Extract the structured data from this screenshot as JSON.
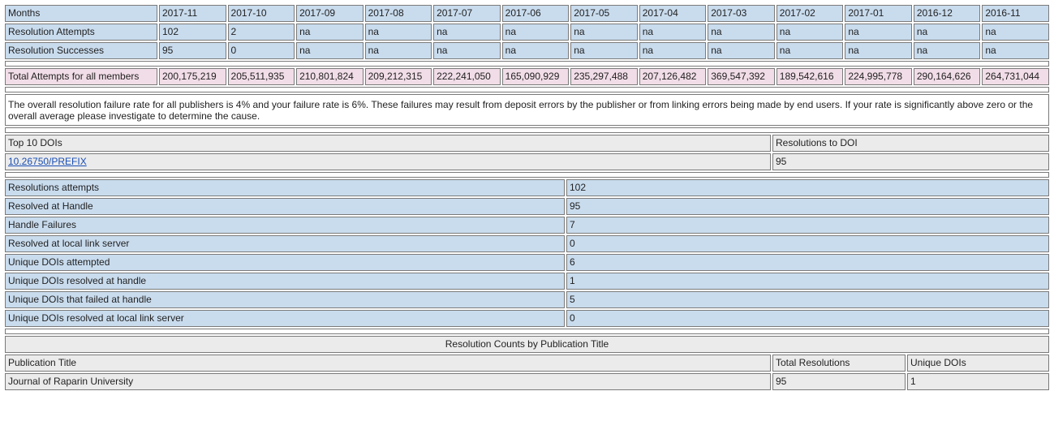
{
  "months_label": "Months",
  "months": [
    "2017-11",
    "2017-10",
    "2017-09",
    "2017-08",
    "2017-07",
    "2017-06",
    "2017-05",
    "2017-04",
    "2017-03",
    "2017-02",
    "2017-01",
    "2016-12",
    "2016-11"
  ],
  "attempts_label": "Resolution Attempts",
  "attempts": [
    "102",
    "2",
    "na",
    "na",
    "na",
    "na",
    "na",
    "na",
    "na",
    "na",
    "na",
    "na",
    "na"
  ],
  "successes_label": "Resolution Successes",
  "successes": [
    "95",
    "0",
    "na",
    "na",
    "na",
    "na",
    "na",
    "na",
    "na",
    "na",
    "na",
    "na",
    "na"
  ],
  "total_label": "Total Attempts for all members",
  "totals": [
    "200,175,219",
    "205,511,935",
    "210,801,824",
    "209,212,315",
    "222,241,050",
    "165,090,929",
    "235,297,488",
    "207,126,482",
    "369,547,392",
    "189,542,616",
    "224,995,778",
    "290,164,626",
    "264,731,044"
  ],
  "note": "The overall resolution failure rate for all publishers is 4% and your failure rate is 6%. These failures may result from deposit errors by the publisher or from linking errors being made by end users. If your rate is significantly above zero or the overall average please investigate to determine the cause.",
  "top_dois": {
    "header": "Top 10 DOIs",
    "count_header": "Resolutions to DOI",
    "rows": [
      {
        "doi": "10.26750/PREFIX",
        "count": "95"
      }
    ]
  },
  "summary": [
    {
      "label": "Resolutions attempts",
      "value": "102"
    },
    {
      "label": "Resolved at Handle",
      "value": "95"
    },
    {
      "label": "Handle Failures",
      "value": "7"
    },
    {
      "label": "Resolved at local link server",
      "value": "0"
    },
    {
      "label": "Unique DOIs attempted",
      "value": "6"
    },
    {
      "label": "Unique DOIs resolved at handle",
      "value": "1"
    },
    {
      "label": "Unique DOIs that failed at handle",
      "value": "5"
    },
    {
      "label": "Unique DOIs resolved at local link server",
      "value": "0"
    }
  ],
  "pub_section": {
    "title": "Resolution Counts by Publication Title",
    "col_title": "Publication Title",
    "col_total": "Total Resolutions",
    "col_unique": "Unique DOIs",
    "rows": [
      {
        "title": "Journal of Raparin University",
        "total": "95",
        "unique": "1"
      }
    ]
  }
}
